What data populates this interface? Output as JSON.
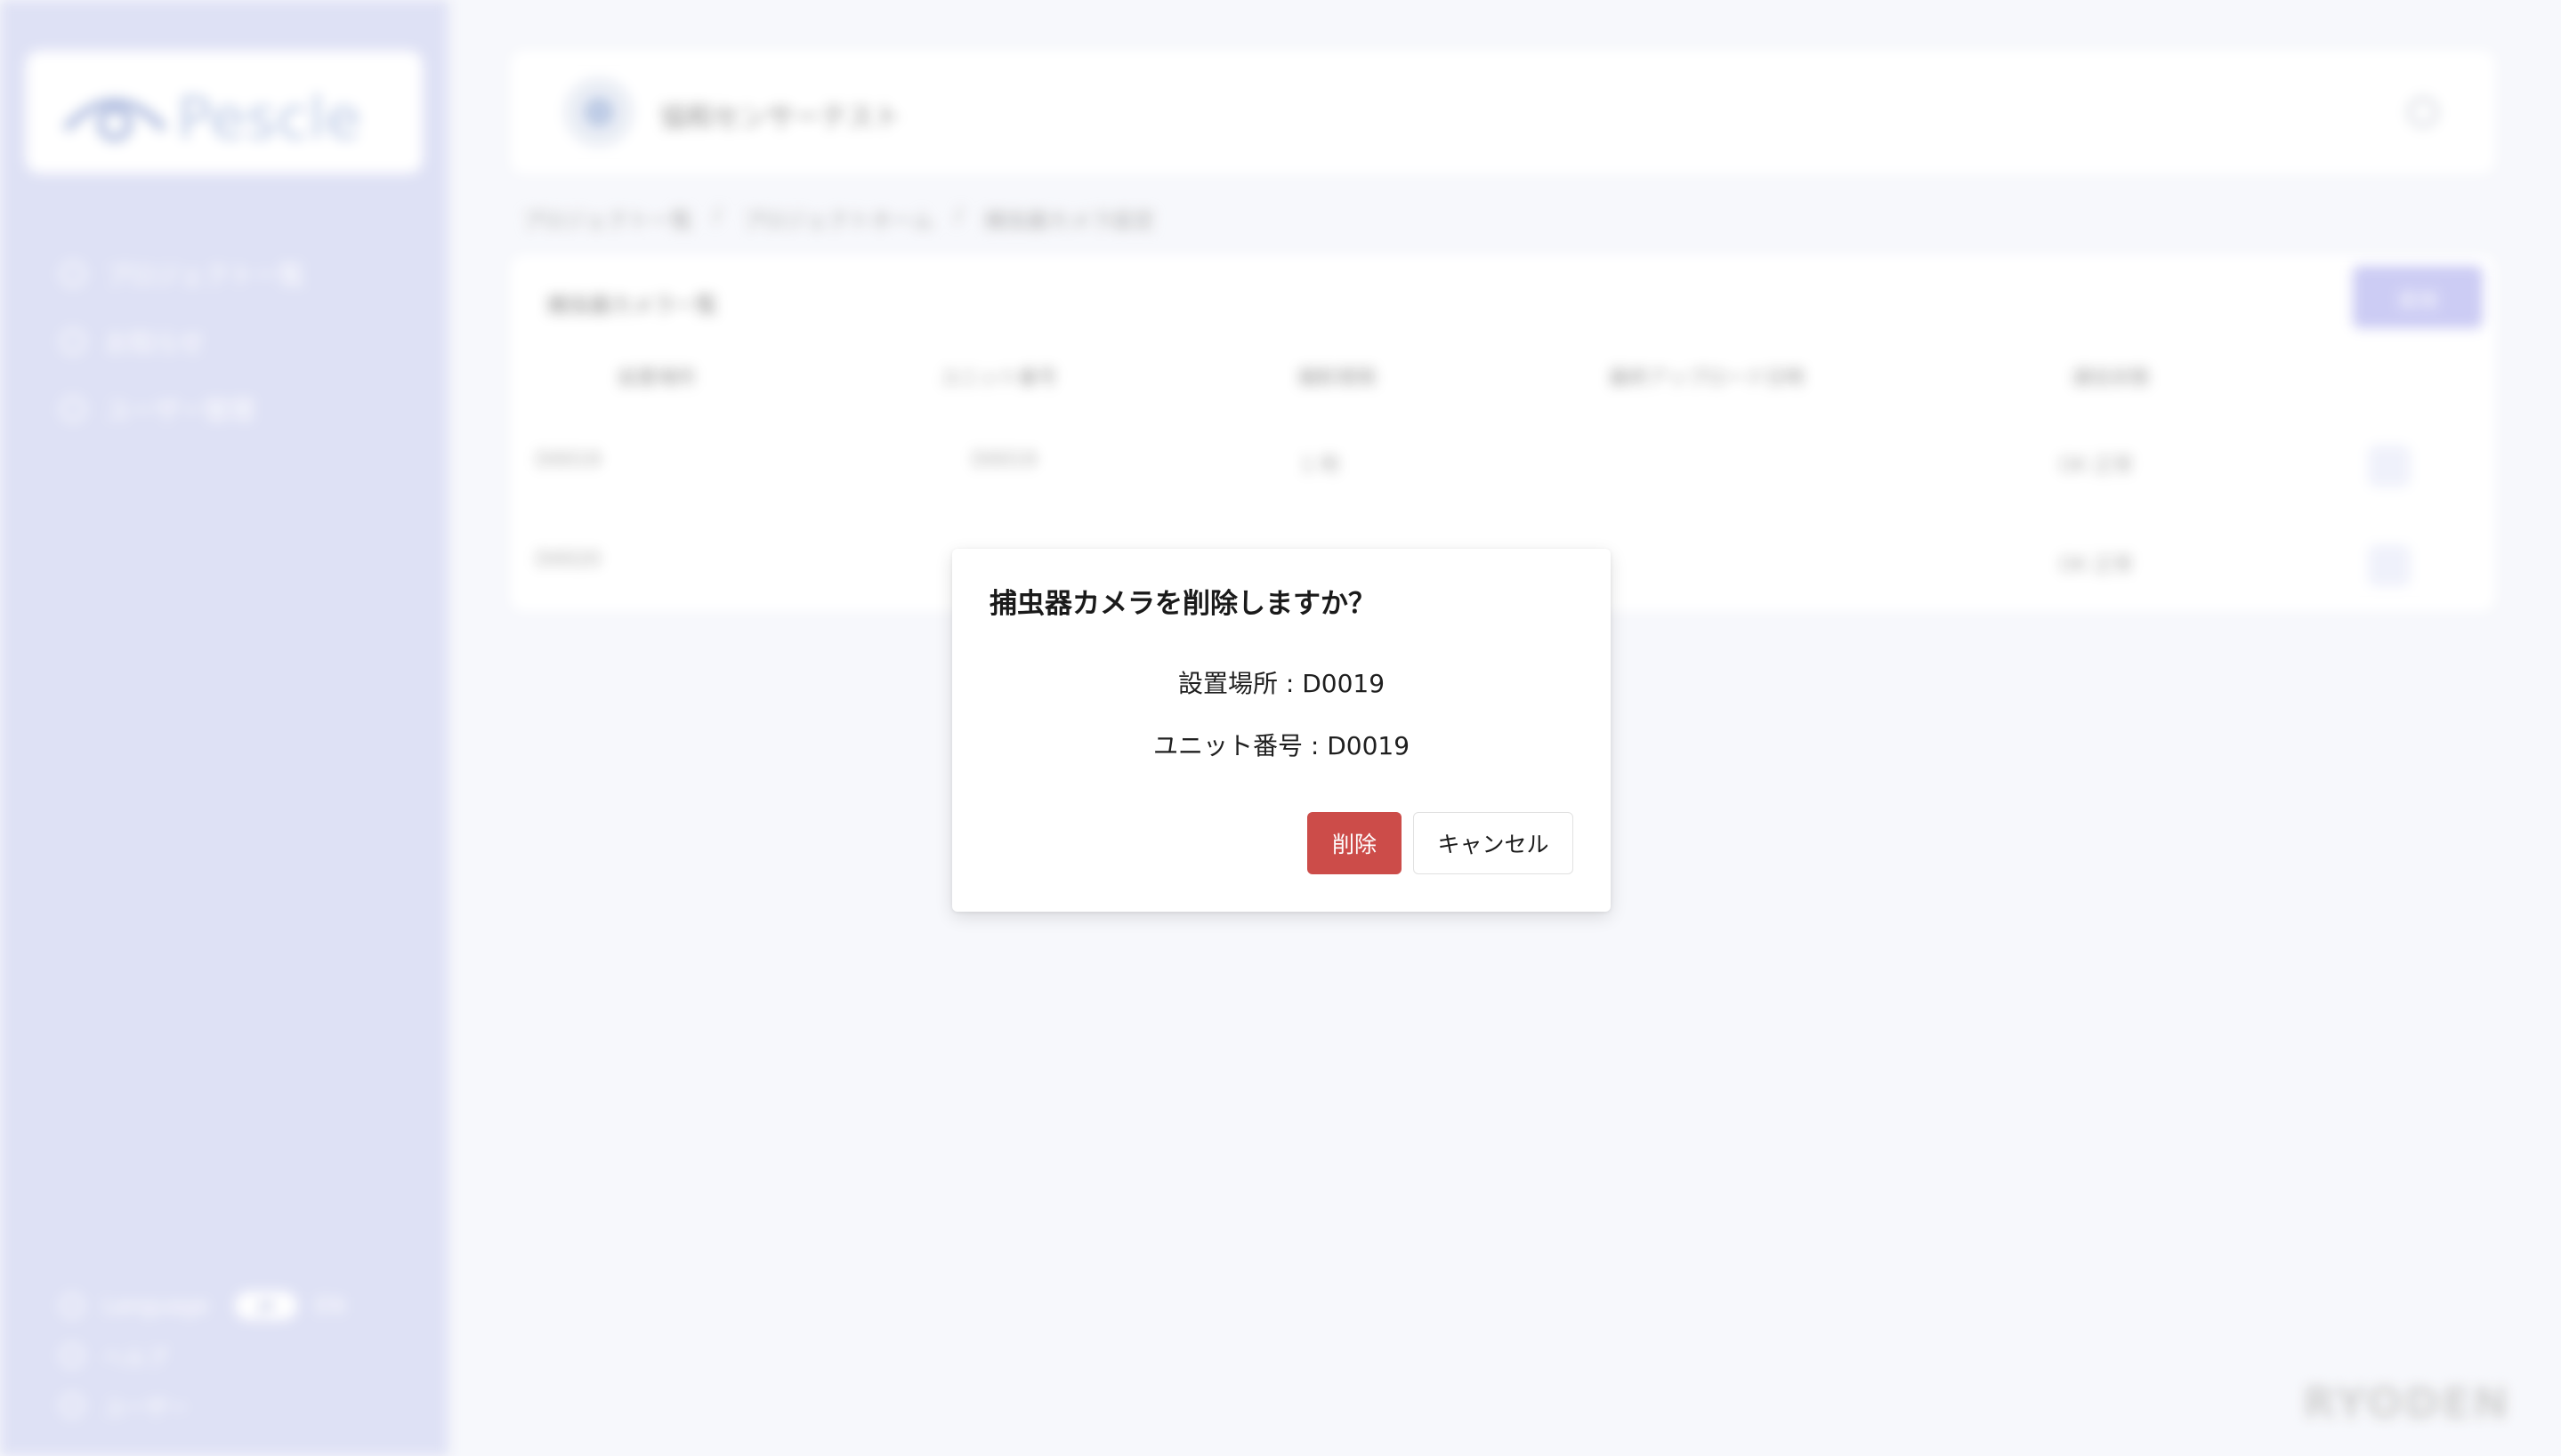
{
  "app": {
    "logo_text": "Pescle",
    "project_name": "協和センサーテスト",
    "sidebar": {
      "items": [
        {
          "label": "プロジェクト一覧",
          "icon": "list-icon"
        },
        {
          "label": "お知らせ",
          "icon": "bell-icon"
        },
        {
          "label": "ユーザー管理",
          "icon": "user-icon"
        }
      ],
      "language_label": "Language",
      "language_current": "JA",
      "language_other": "EN",
      "help_label": "ヘルプ",
      "user_label": "ユーザー"
    },
    "breadcrumb": [
      "プロジェクト一覧",
      "プロジェクトホーム",
      "捕虫器カメラ設定"
    ],
    "card": {
      "title": "捕虫器カメラ一覧",
      "add_button": "追加",
      "columns": [
        "設置場所",
        "ユニット番号",
        "撮影間隔",
        "最終アップロード日時",
        "通信状態"
      ],
      "rows": [
        {
          "location": "D0019",
          "unit": "D0019",
          "interval": "1 時",
          "upload": "",
          "status": "OK 正常"
        },
        {
          "location": "D0020",
          "unit": "",
          "interval": "",
          "upload": "",
          "status": "OK 正常"
        }
      ]
    },
    "footer_brand": "RYODEN"
  },
  "modal": {
    "title": "捕虫器カメラを削除しますか？",
    "location_line": "設置場所 : D0019",
    "unit_line": "ユニット番号 : D0019",
    "delete_label": "削除",
    "cancel_label": "キャンセル"
  },
  "colors": {
    "sidebar_bg": "#dcdff5",
    "delete_button": "#cc4c49",
    "add_button": "#c8c8f4"
  }
}
